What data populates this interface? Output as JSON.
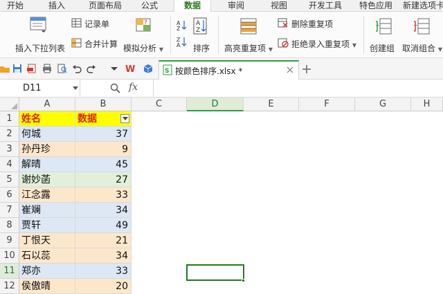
{
  "menu": {
    "tabs": [
      "开始",
      "插入",
      "页面布局",
      "公式",
      "数据",
      "审阅",
      "视图",
      "开发工具",
      "特色应用",
      "新建选项卡"
    ],
    "active": "数据"
  },
  "ribbon": {
    "insert_dropdown": "插入下拉列表",
    "record_sheet": "记录单",
    "merge_calc": "合并计算",
    "simulate_analysis": "模拟分析",
    "sort": "排序",
    "highlight_dup": "高亮重复项",
    "remove_dup": "删除重复项",
    "reject_dup": "拒绝录入重复项",
    "create_group": "创建组",
    "ungroup": "取消组合"
  },
  "doc": {
    "filename": "按颜色排序.xlsx *"
  },
  "formula_bar": {
    "name_box": "D11",
    "fx": "fx",
    "value": ""
  },
  "sheet": {
    "columns": [
      "A",
      "B",
      "C",
      "D",
      "E",
      "F",
      "G",
      "H"
    ],
    "selected_column": "D",
    "selected_row": "11",
    "header": {
      "name": "姓名",
      "data": "数据"
    },
    "rows": [
      {
        "row": "2",
        "name": "何城",
        "value": "37",
        "fill": "blue"
      },
      {
        "row": "3",
        "name": "孙丹珍",
        "value": "9",
        "fill": "peach"
      },
      {
        "row": "4",
        "name": "解晴",
        "value": "45",
        "fill": "blue"
      },
      {
        "row": "5",
        "name": "谢妙菡",
        "value": "27",
        "fill": "green"
      },
      {
        "row": "6",
        "name": "江念露",
        "value": "33",
        "fill": "peach"
      },
      {
        "row": "7",
        "name": "崔斓",
        "value": "34",
        "fill": "blue"
      },
      {
        "row": "8",
        "name": "贾轩",
        "value": "49",
        "fill": "blue"
      },
      {
        "row": "9",
        "name": "丁恨天",
        "value": "21",
        "fill": "peach"
      },
      {
        "row": "10",
        "name": "石以蕊",
        "value": "34",
        "fill": "peach"
      },
      {
        "row": "11",
        "name": "郑亦",
        "value": "33",
        "fill": "blue"
      },
      {
        "row": "12",
        "name": "侯傲晴",
        "value": "20",
        "fill": "peach"
      }
    ]
  },
  "colors": {
    "accent": "#2e9e3e",
    "header_fill": "#ffff00",
    "header_text": "#e02020",
    "fill_blue": "#dde8f4",
    "fill_peach": "#fde7cb",
    "fill_green": "#e2efda"
  }
}
